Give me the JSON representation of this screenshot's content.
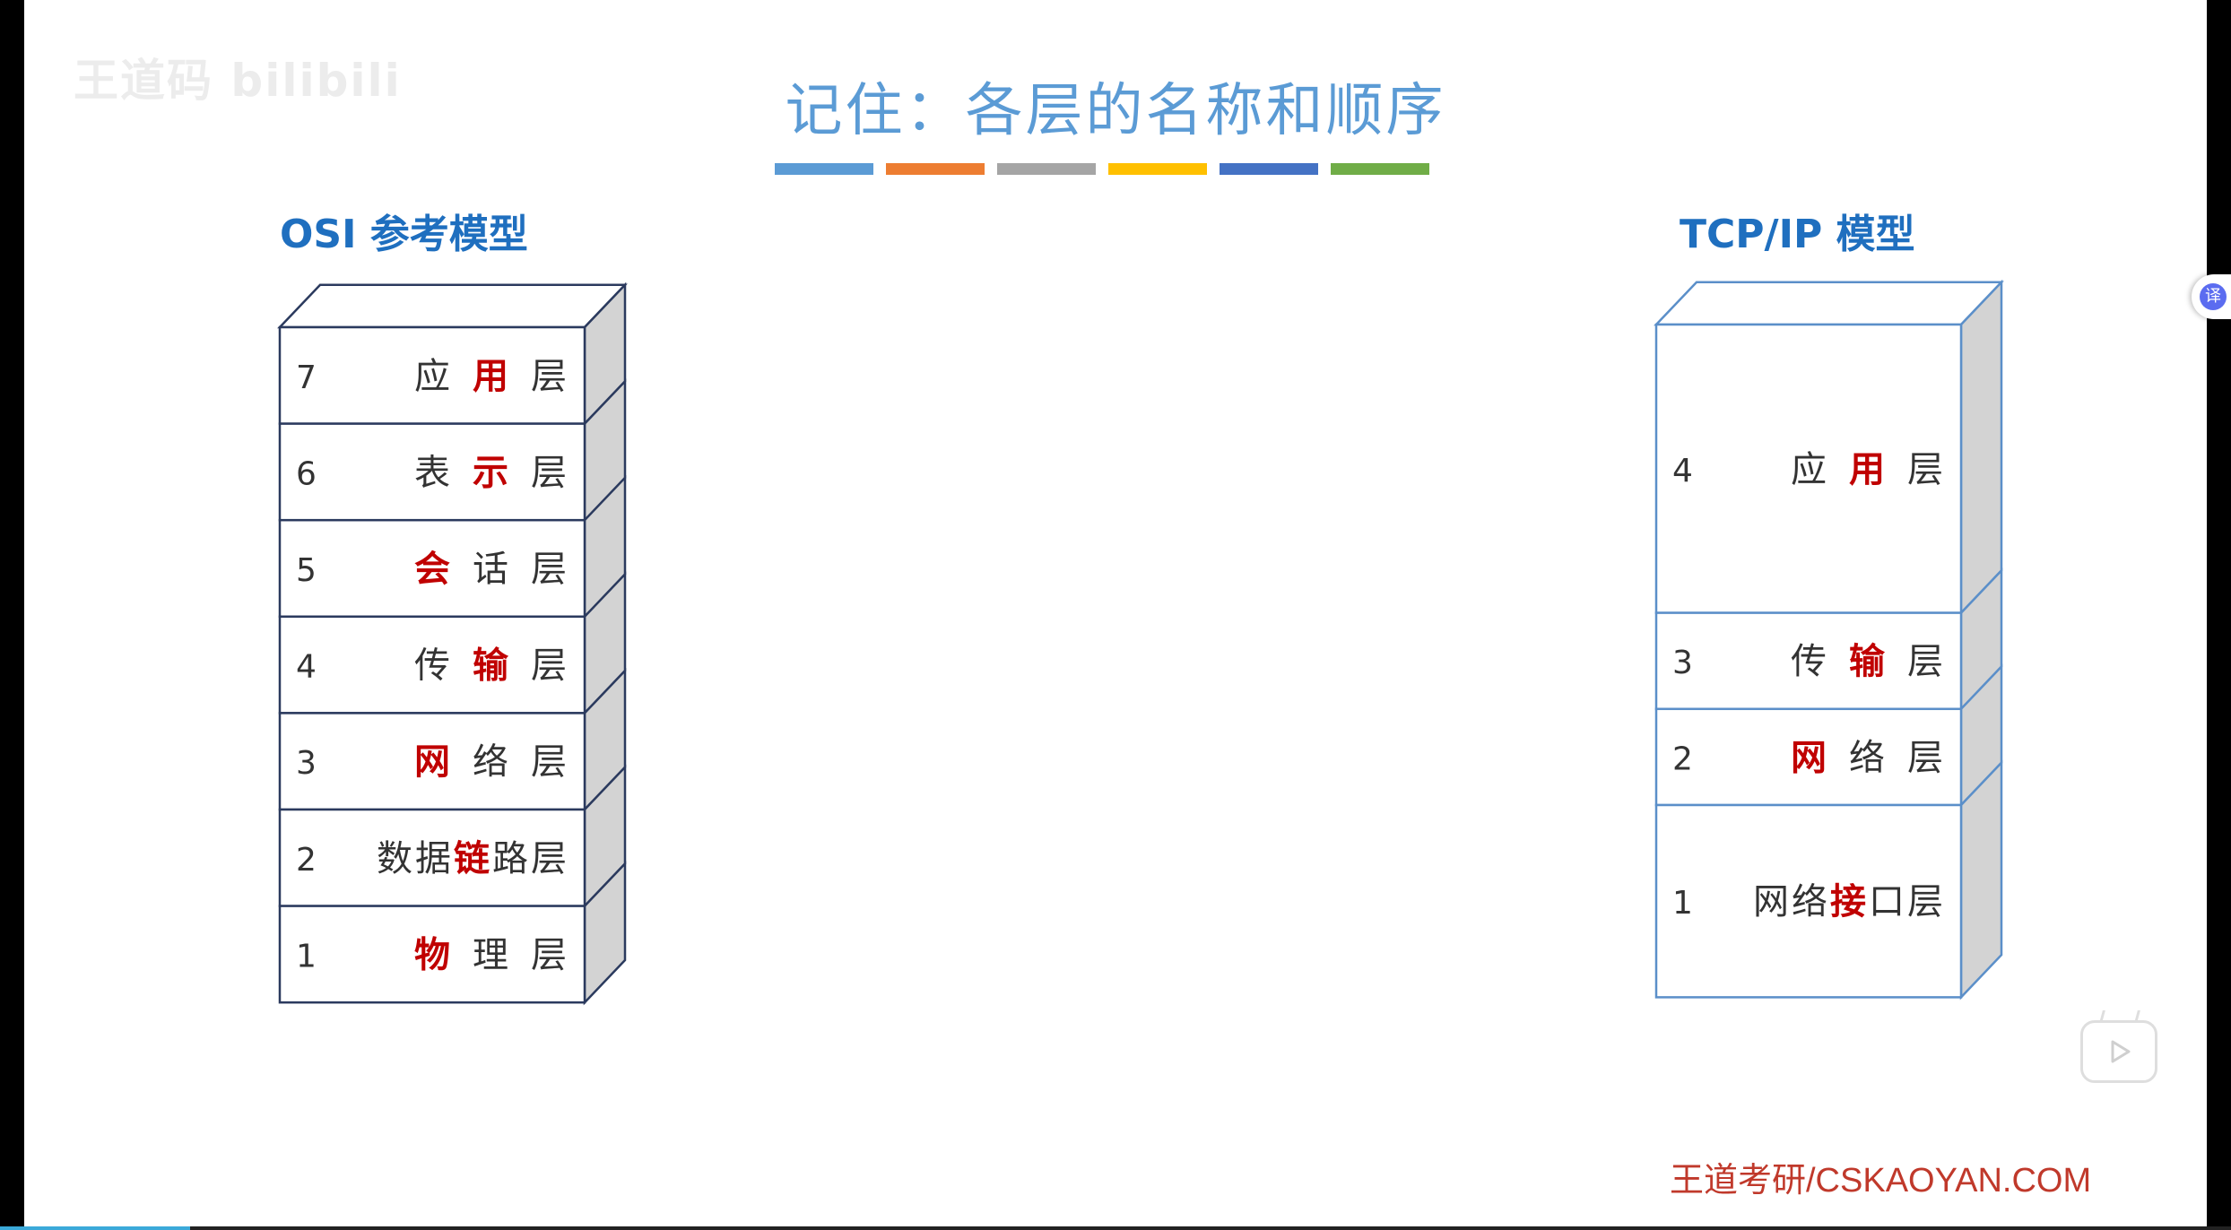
{
  "watermark": "王道码 bilibili",
  "slide": {
    "title": "记住：各层的名称和顺序",
    "accent_colors": [
      "#5b9bd5",
      "#ed7d31",
      "#a5a5a5",
      "#ffc000",
      "#4472c4",
      "#70ad47"
    ],
    "highlight_color": "#c00000",
    "text_color": "#333333",
    "osi": {
      "title": "OSI 参考模型",
      "layers": [
        {
          "num": "7",
          "chars": [
            "应",
            "用",
            "层"
          ],
          "hl": 1
        },
        {
          "num": "6",
          "chars": [
            "表",
            "示",
            "层"
          ],
          "hl": 1
        },
        {
          "num": "5",
          "chars": [
            "会",
            "话",
            "层"
          ],
          "hl": 0
        },
        {
          "num": "4",
          "chars": [
            "传",
            "输",
            "层"
          ],
          "hl": 1
        },
        {
          "num": "3",
          "chars": [
            "网",
            "络",
            "层"
          ],
          "hl": 0
        },
        {
          "num": "2",
          "chars": [
            "数",
            "据",
            "链",
            "路",
            "层"
          ],
          "hl": 2
        },
        {
          "num": "1",
          "chars": [
            "物",
            "理",
            "层"
          ],
          "hl": 0
        }
      ]
    },
    "tcpip": {
      "title": "TCP/IP 模型",
      "layers": [
        {
          "num": "4",
          "chars": [
            "应",
            "用",
            "层"
          ],
          "hl": 1,
          "rows": 3
        },
        {
          "num": "3",
          "chars": [
            "传",
            "输",
            "层"
          ],
          "hl": 1,
          "rows": 1
        },
        {
          "num": "2",
          "chars": [
            "网",
            "络",
            "层"
          ],
          "hl": 0,
          "rows": 1
        },
        {
          "num": "1",
          "chars": [
            "网",
            "络",
            "接",
            "口",
            "层"
          ],
          "hl": 2,
          "rows": 2
        }
      ]
    },
    "footer": "王道考研/CSKAOYAN.COM"
  },
  "overlay": {
    "translate_icon": "translate-icon",
    "translate_label": "译",
    "play_icon": "play-icon"
  }
}
